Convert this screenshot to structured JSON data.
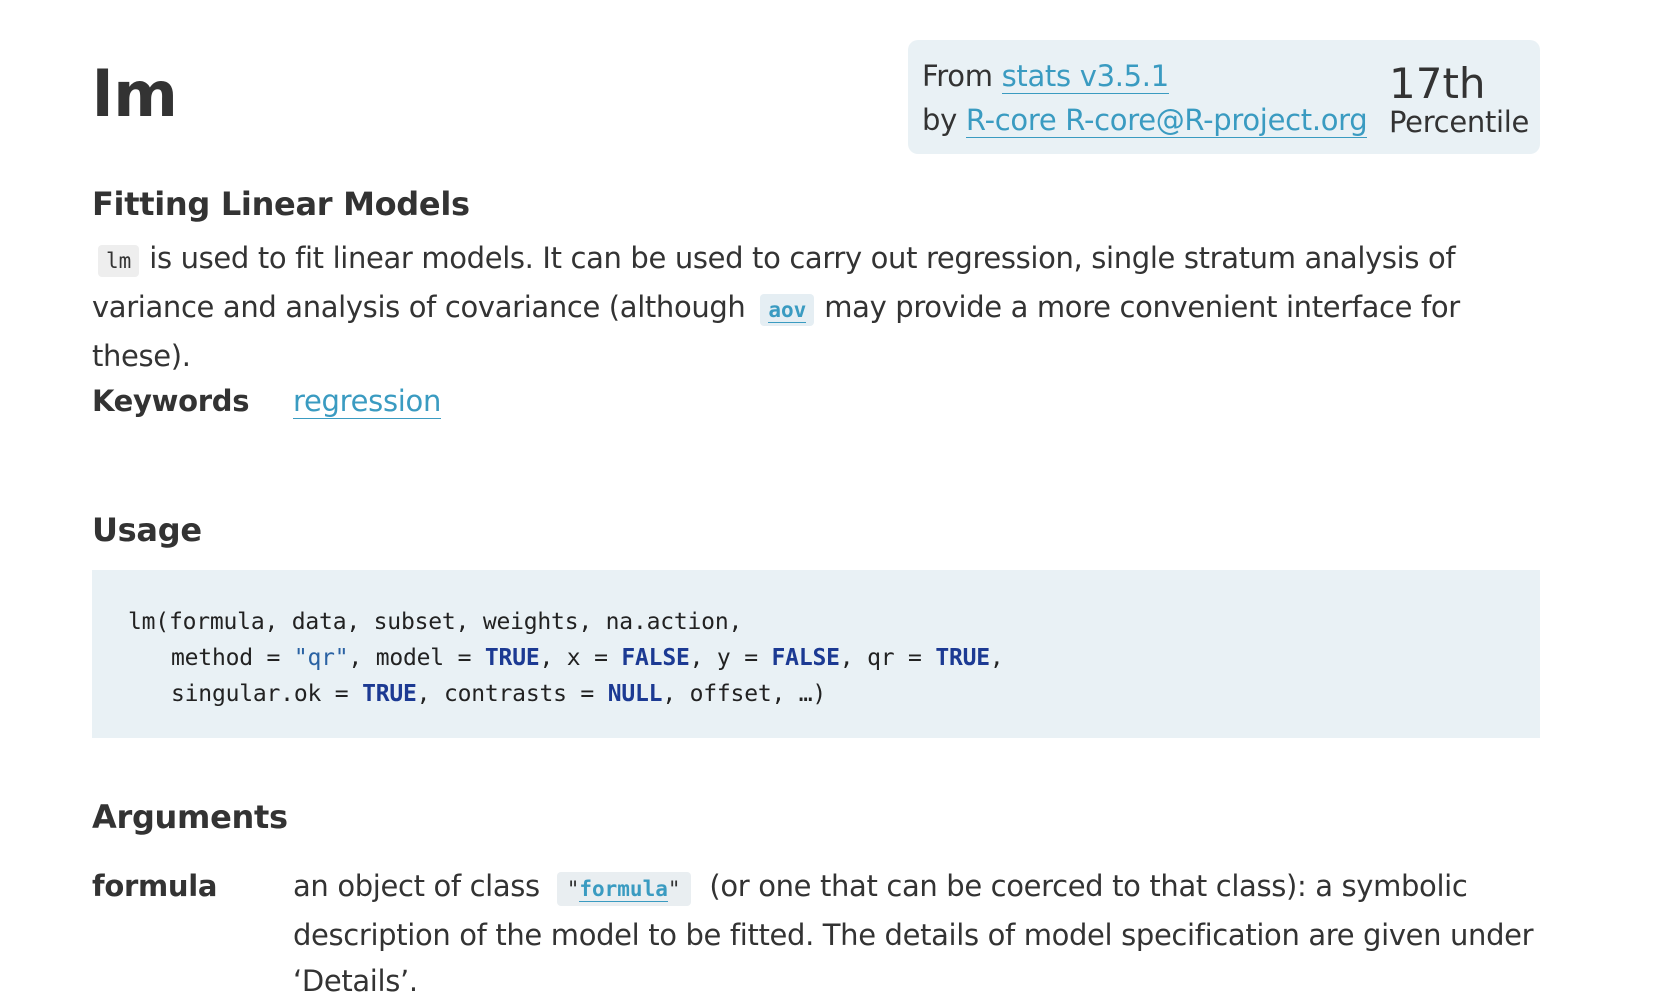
{
  "header": {
    "title": "lm",
    "from_prefix": "From",
    "package_link": "stats v3.5.1",
    "by_prefix": "by",
    "author_link": "R-core R-core@R-project.org",
    "percentile_value": "17th",
    "percentile_label": "Percentile"
  },
  "description": {
    "heading": "Fitting Linear Models",
    "code_lm": "lm",
    "text_1": "is used to fit linear models. It can be used to carry out regression, single stratum analysis of variance and analysis of covariance (although",
    "code_aov": "aov",
    "text_2": "may provide a more convenient interface for these)."
  },
  "keywords": {
    "label": "Keywords",
    "items": [
      "regression"
    ]
  },
  "usage": {
    "heading": "Usage",
    "line1": "lm(formula, data, subset, weights, na.action,",
    "l2_a": "method = ",
    "l2_b": "\"qr\"",
    "l2_c": ", model = ",
    "l2_d": "TRUE",
    "l2_e": ", x = ",
    "l2_f": "FALSE",
    "l2_g": ", y = ",
    "l2_h": "FALSE",
    "l2_i": ", qr = ",
    "l2_j": "TRUE",
    "l2_k": ",",
    "l3_a": "singular.ok = ",
    "l3_b": "TRUE",
    "l3_c": ", contrasts = ",
    "l3_d": "NULL",
    "l3_e": ", offset, …)"
  },
  "arguments": {
    "heading": "Arguments",
    "items": [
      {
        "name": "formula",
        "text_1": "an object of class",
        "quote_open": "\"",
        "code_link": "formula",
        "quote_close": "\"",
        "text_2": "(or one that can be coerced to that class): a symbolic description of the model to be fitted. The details of model specification are given under ‘Details’."
      }
    ]
  },
  "colors": {
    "link": "#3a9bc1",
    "panel_bg": "#e9f1f5",
    "text": "#333333",
    "code_keyword": "#1c3a93"
  }
}
